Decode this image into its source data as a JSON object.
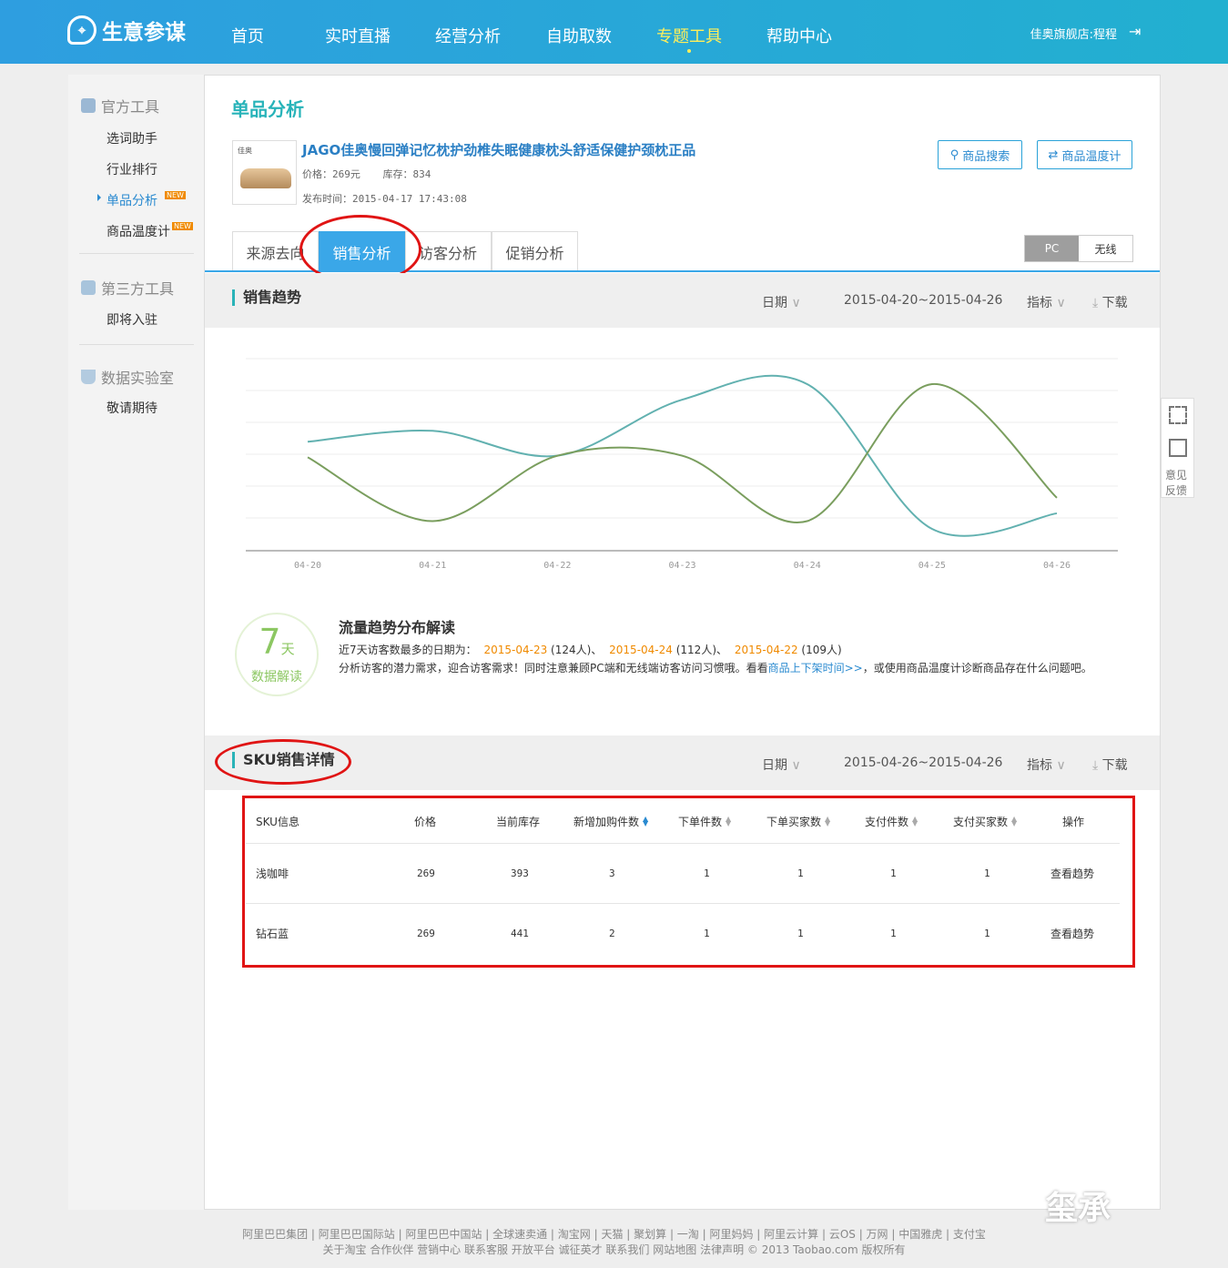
{
  "header": {
    "logo": "生意参谋",
    "nav": [
      "首页",
      "实时直播",
      "经营分析",
      "自助取数",
      "专题工具",
      "帮助中心"
    ],
    "active_nav": "专题工具",
    "user": "佳奥旗舰店:程程"
  },
  "sidebar": {
    "groups": [
      {
        "title": "官方工具",
        "items": [
          "选词助手",
          "行业排行",
          "单品分析",
          "商品温度计"
        ]
      },
      {
        "title": "第三方工具",
        "items": [
          "即将入驻"
        ]
      },
      {
        "title": "数据实验室",
        "items": [
          "敬请期待"
        ]
      }
    ],
    "new_badge": "NEW"
  },
  "page": {
    "title": "单品分析"
  },
  "product": {
    "image_brand": "佳奥",
    "name": "JAGO佳奥慢回弹记忆枕护劲椎失眠健康枕头舒适保健护颈枕正品",
    "price_line": "价格：269元",
    "stock_line": "库存：834",
    "publish_line": "发布时间：2015-04-17 17:43:08"
  },
  "buttons": {
    "search": "商品搜索",
    "thermo": "商品温度计"
  },
  "tabs": [
    "来源去向",
    "销售分析",
    "访客分析",
    "促销分析"
  ],
  "device_toggle": [
    "PC",
    "无线"
  ],
  "trend_section": {
    "title": "销售趋势",
    "date_label": "日期",
    "date_range": "2015-04-20~2015-04-26",
    "metric_label": "指标",
    "download": "下载"
  },
  "chart_data": {
    "type": "line",
    "categories": [
      "04-20",
      "04-21",
      "04-22",
      "04-23",
      "04-24",
      "04-25",
      "04-26"
    ],
    "series": [
      {
        "color": "#62b1b0",
        "values": [
          0.63,
          0.7,
          0.54,
          0.9,
          1.0,
          0.07,
          0.17
        ]
      },
      {
        "color": "#7a9e5e",
        "values": [
          0.53,
          0.12,
          0.54,
          0.54,
          0.12,
          1.0,
          0.27
        ]
      }
    ],
    "grid": true,
    "ylim": [
      0,
      1
    ],
    "yticks_visible": false
  },
  "interpretation": {
    "badge_num": "7",
    "badge_unit": "天",
    "badge_label": "数据解读",
    "title": "流量趋势分布解读",
    "line1_prefix": "近7天访客数最多的日期为：",
    "top_dates": [
      {
        "date": "2015-04-23",
        "count": "(124人)、"
      },
      {
        "date": "2015-04-24",
        "count": "(112人)、"
      },
      {
        "date": "2015-04-22",
        "count": "(109人)"
      }
    ],
    "line2_pre": "分析访客的潜力需求，迎合访客需求！同时注意兼顾PC端和无线端访客访问习惯哦。看看",
    "line2_link": "商品上下架时间>>",
    "line2_post": "，或使用商品温度计诊断商品存在什么问题吧。"
  },
  "sku_section": {
    "title": "SKU销售详情",
    "date_label": "日期",
    "date_range": "2015-04-26~2015-04-26",
    "metric_label": "指标",
    "download": "下载"
  },
  "sku_table": {
    "headers": [
      "SKU信息",
      "价格",
      "当前库存",
      "新增加购件数",
      "下单件数",
      "下单买家数",
      "支付件数",
      "支付买家数",
      "操作"
    ],
    "rows": [
      [
        "浅咖啡",
        "269",
        "393",
        "3",
        "1",
        "1",
        "1",
        "1",
        "查看趋势"
      ],
      [
        "钻石蓝",
        "269",
        "441",
        "2",
        "1",
        "1",
        "1",
        "1",
        "查看趋势"
      ]
    ]
  },
  "float_bar": {
    "feedback": "意见反馈"
  },
  "footer": {
    "links1": "阿里巴巴集团 | 阿里巴巴国际站 | 阿里巴巴中国站 | 全球速卖通 | 淘宝网 | 天猫 | 聚划算 | 一淘 | 阿里妈妈 | 阿里云计算 | 云OS | 万网 | 中国雅虎 | 支付宝",
    "links2": "关于淘宝 合作伙伴 营销中心 联系客服 开放平台 诚征英才 联系我们 网站地图 法律声明 © 2013 Taobao.com 版权所有"
  },
  "watermark": "玺承"
}
